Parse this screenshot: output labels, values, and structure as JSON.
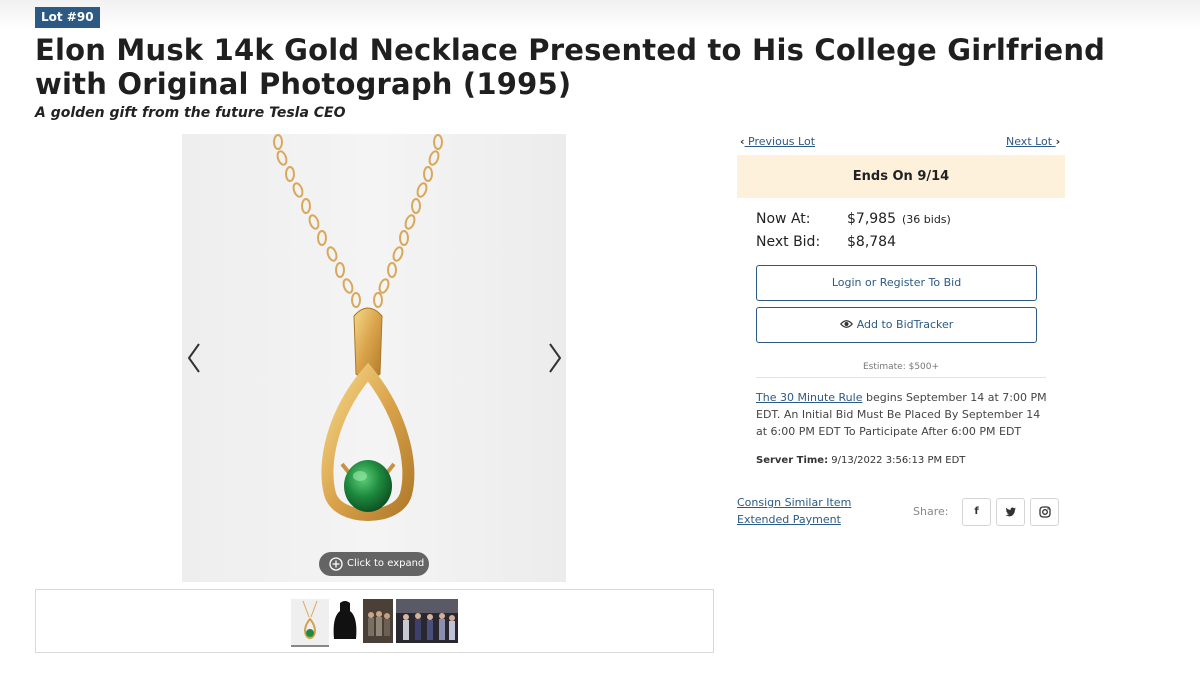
{
  "lot": {
    "badge": "Lot #90"
  },
  "item": {
    "title": "Elon Musk 14k Gold Necklace Presented to His College Girlfriend with Original Photograph (1995)",
    "subtitle": "A golden gift from the future Tesla CEO"
  },
  "gallery": {
    "expand_label": "Click to expand",
    "thumbnail_count": 4,
    "active_thumbnail": 1
  },
  "navigation": {
    "previous_label": "Previous Lot",
    "next_label": "Next Lot"
  },
  "auction": {
    "ends_label": "Ends On 9/14",
    "now_at_label": "Now At:",
    "now_at_value": "$7,985",
    "bids_count": "(36 bids)",
    "next_bid_label": "Next Bid:",
    "next_bid_value": "$8,784",
    "login_button": "Login or Register To Bid",
    "bidtracker_button": "Add to BidTracker",
    "estimate": "Estimate: $500+",
    "rule_link": "The 30 Minute Rule",
    "rule_text": " begins September 14 at 7:00 PM EDT. An Initial Bid Must Be Placed By September 14 at 6:00 PM EDT To Participate After 6:00 PM EDT",
    "server_time_label": "Server Time:",
    "server_time_value": " 9/13/2022 3:56:13 PM EDT"
  },
  "links": {
    "consign": "Consign Similar Item",
    "extended_payment": "Extended Payment"
  },
  "share": {
    "label": "Share:",
    "icons": [
      "facebook-icon",
      "twitter-icon",
      "instagram-icon"
    ]
  },
  "colors": {
    "brand_blue": "#2c5a85",
    "ends_banner": "#fdf1dc",
    "gold": "#e3b15a",
    "emerald": "#1e8a3e"
  }
}
